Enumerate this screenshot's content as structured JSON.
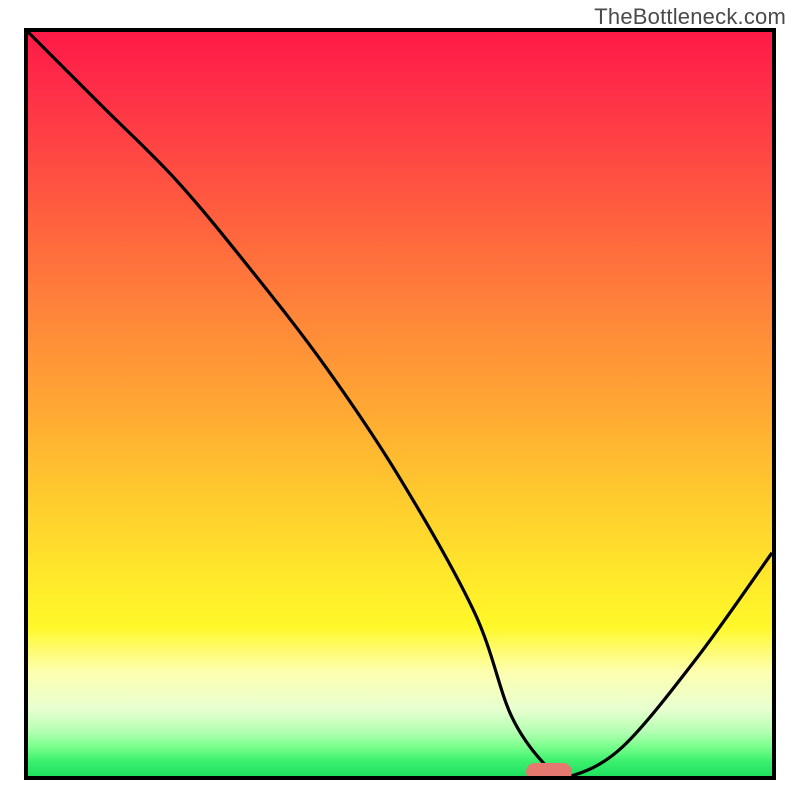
{
  "watermark": "TheBottleneck.com",
  "accent_pill_color": "#e5786f",
  "gradient_stops": [
    "#ff1a47",
    "#ff5740",
    "#ffa634",
    "#ffe52b",
    "#fdffb0",
    "#7cff8c",
    "#20e060"
  ],
  "chart_data": {
    "type": "line",
    "title": "",
    "xlabel": "",
    "ylabel": "",
    "xlim": [
      0,
      100
    ],
    "ylim": [
      0,
      100
    ],
    "series": [
      {
        "name": "bottleneck-curve",
        "x": [
          0,
          10,
          20,
          30,
          40,
          50,
          60,
          65,
          70,
          73,
          80,
          90,
          100
        ],
        "values": [
          100,
          90,
          80,
          68,
          55,
          40,
          22,
          8,
          1,
          0,
          4,
          16,
          30
        ]
      }
    ],
    "marker": {
      "x": 70,
      "y": 0.5
    }
  }
}
